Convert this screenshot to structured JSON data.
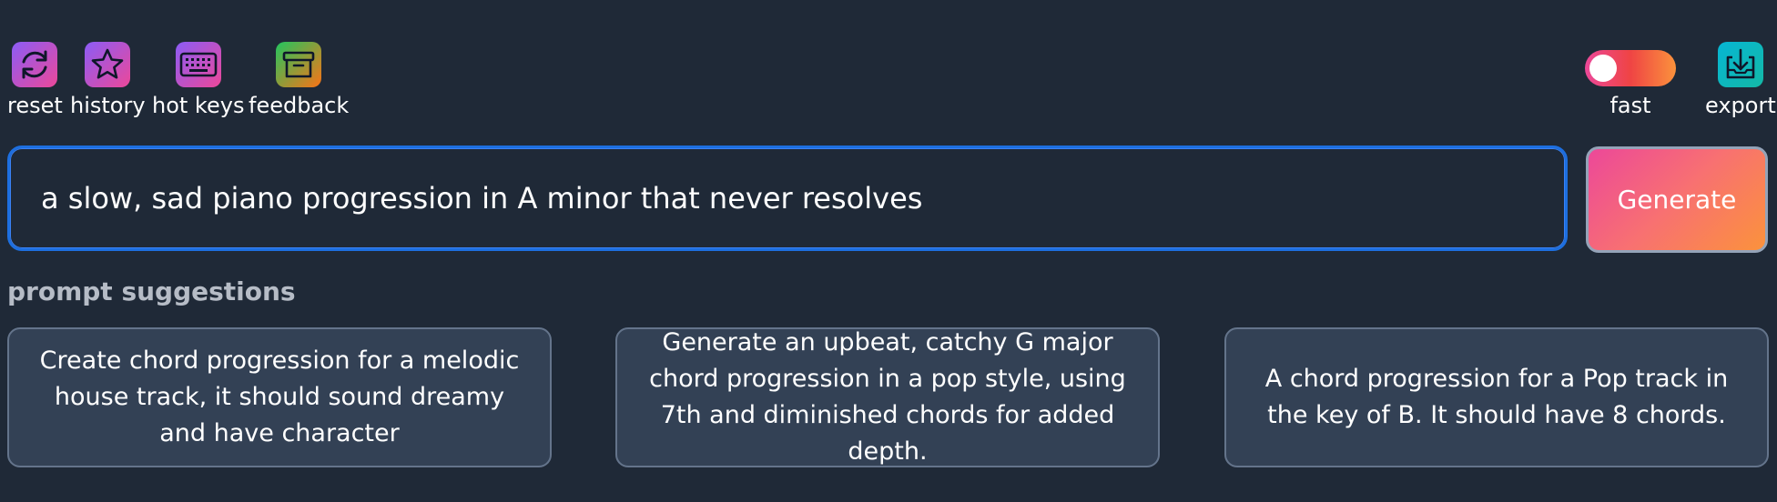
{
  "toolbar": {
    "reset_label": "reset",
    "history_label": "history",
    "hotkeys_label": "hot keys",
    "feedback_label": "feedback",
    "fast_label": "fast",
    "export_label": "export",
    "fast_toggle_on": false
  },
  "prompt": {
    "value": "a slow, sad piano progression in A minor that never resolves",
    "generate_label": "Generate"
  },
  "suggestions": {
    "title": "prompt suggestions",
    "items": [
      "Create chord progression for a melodic house track, it should sound dreamy and have character",
      "Generate an upbeat, catchy G major chord progression in a pop style, using 7th and diminished chords for added depth.",
      "A chord progression for a Pop track in the key of B. It should have 8 chords."
    ]
  },
  "colors": {
    "background": "#1f2937",
    "card": "#334155",
    "focus_border": "#1d6fe0",
    "accent_pink": "#ec4899",
    "accent_orange": "#fb923c"
  },
  "icons": [
    "refresh-icon",
    "star-icon",
    "keyboard-icon",
    "archive-box-icon",
    "download-tray-icon"
  ]
}
